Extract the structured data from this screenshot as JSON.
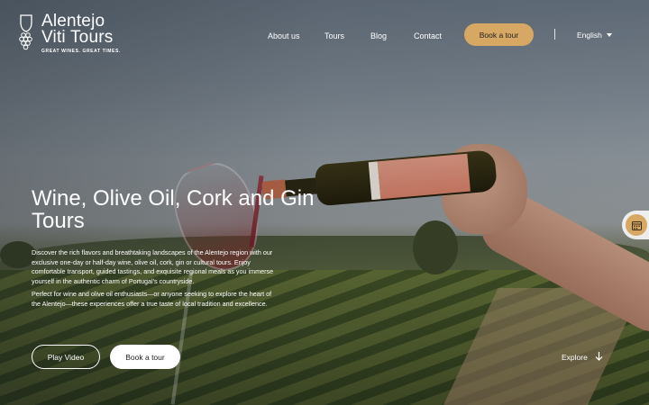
{
  "brand": {
    "line1": "Alentejo",
    "line2": "Viti Tours",
    "tagline": "GREAT WINES. GREAT TIMES."
  },
  "nav": {
    "about": "About us",
    "tours": "Tours",
    "blog": "Blog",
    "contact": "Contact",
    "book": "Book a tour",
    "language": "English"
  },
  "hero": {
    "title": "Wine, Olive Oil, Cork and Gin Tours",
    "desc1": "Discover the rich flavors and breathtaking landscapes of the Alentejo region with our exclusive one-day or half-day wine, olive oil, cork, gin or cultural tours. Enjoy comfortable transport, guided tastings, and exquisite regional meals as you immerse yourself in the authentic charm of Portugal's countryside.",
    "desc2": "Perfect for wine and olive oil enthusiasts—or anyone seeking to explore the heart of the Alentejo—these experiences offer a true taste of local tradition and excellence.",
    "play_label": "Play Video",
    "book_label": "Book a tour",
    "explore_label": "Explore"
  },
  "colors": {
    "accent": "#d7a764",
    "text": "#ffffff"
  },
  "icons": {
    "logo": "wine-glass-grapes-icon",
    "caret": "chevron-down-icon",
    "explore": "arrow-down-icon",
    "calendar": "calendar-icon"
  }
}
